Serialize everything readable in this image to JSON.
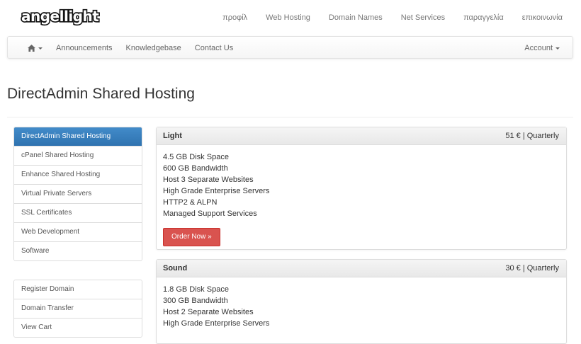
{
  "brand": {
    "logo_text": "angellight"
  },
  "topnav": [
    "προφίλ",
    "Web Hosting",
    "Domain Names",
    "Net Services",
    "παραγγελία",
    "επικοινωνία"
  ],
  "navbar": {
    "home_icon": "home-icon",
    "items": [
      "Announcements",
      "Knowledgebase",
      "Contact Us"
    ],
    "account_label": "Account"
  },
  "page": {
    "title": "DirectAdmin Shared Hosting"
  },
  "sidebar": {
    "categories": [
      "DirectAdmin Shared Hosting",
      "cPanel Shared Hosting",
      "Enhance Shared Hosting",
      "Virtual Private Servers",
      "SSL Certificates",
      "Web Development",
      "Software"
    ],
    "actions": [
      "Register Domain",
      "Domain Transfer",
      "View Cart"
    ]
  },
  "products": [
    {
      "name": "Light",
      "price": "51 € | Quarterly",
      "features": [
        "4.5 GB Disk Space",
        "600 GB Bandwidth",
        "Host 3 Separate Websites",
        "High Grade Enterprise Servers",
        "HTTP2 & ALPN",
        "Managed Support Services"
      ],
      "order_label": "Order Now »"
    },
    {
      "name": "Sound",
      "price": "30 € | Quarterly",
      "features": [
        "1.8 GB Disk Space",
        "300 GB Bandwidth",
        "Host 2 Separate Websites",
        "High Grade Enterprise Servers"
      ]
    }
  ],
  "colors": {
    "active": "#428bca",
    "order_button": "#d9534f"
  }
}
